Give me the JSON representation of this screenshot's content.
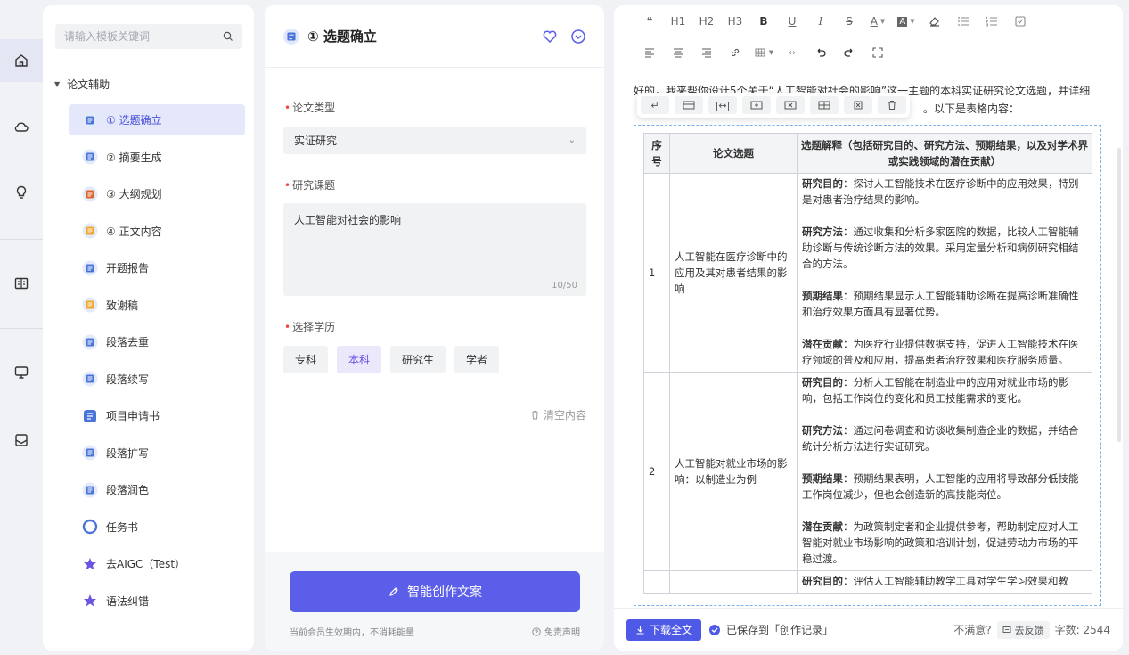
{
  "rail": {
    "icons": [
      "home-icon",
      "cloud-icon",
      "lightbulb-icon",
      "book-icon",
      "monitor-icon",
      "mail-icon"
    ]
  },
  "sidebar": {
    "search_placeholder": "请输入模板关键词",
    "group_label": "论文辅助",
    "items": [
      {
        "label": "① 选题确立",
        "icon": "topic-icon"
      },
      {
        "label": "② 摘要生成",
        "icon": "abstract-icon"
      },
      {
        "label": "③ 大纲规划",
        "icon": "outline-icon"
      },
      {
        "label": "④ 正文内容",
        "icon": "body-icon"
      },
      {
        "label": "开题报告",
        "icon": "report-icon"
      },
      {
        "label": "致谢稿",
        "icon": "thanks-icon"
      },
      {
        "label": "段落去重",
        "icon": "dedupe-icon"
      },
      {
        "label": "段落续写",
        "icon": "continue-icon"
      },
      {
        "label": "项目申请书",
        "icon": "proposal-icon"
      },
      {
        "label": "段落扩写",
        "icon": "expand-icon"
      },
      {
        "label": "段落润色",
        "icon": "polish-icon"
      },
      {
        "label": "任务书",
        "icon": "task-icon"
      },
      {
        "label": "去AIGC（Test）",
        "icon": "star-icon"
      },
      {
        "label": "语法纠错",
        "icon": "star-icon"
      }
    ]
  },
  "form": {
    "title": "① 选题确立",
    "type_label": "论文类型",
    "type_value": "实证研究",
    "topic_label": "研究课题",
    "topic_value": "人工智能对社会的影响",
    "topic_count": "10/50",
    "degree_label": "选择学历",
    "degree_options": [
      "专科",
      "本科",
      "研究生",
      "学者"
    ],
    "clear_label": "清空内容",
    "generate_label": "智能创作文案",
    "member_note": "当前会员生效期内，不消耗能量",
    "disclaimer": "免责声明"
  },
  "editor": {
    "toolbar_row1": [
      "❝",
      "H1",
      "H2",
      "H3",
      "B",
      "U",
      "I",
      "S",
      "A",
      "A",
      "⌫",
      "☰",
      "☷",
      "☑"
    ],
    "intro_line1": "好的，我来帮你设计5个关于“人工智能对社会的影响”这一主题的本科实证研究论文选题，并详细",
    "intro_line2": "。以下是表格内容：",
    "table": {
      "headers": [
        "序号",
        "论文选题",
        "选题解释（包括研究目的、研究方法、预期结果，以及对学术界或实践领域的潜在贡献）"
      ],
      "rows": [
        {
          "no": "1",
          "title": "人工智能在医疗诊断中的应用及其对患者结果的影响",
          "purpose_k": "研究目的",
          "purpose": "：探讨人工智能技术在医疗诊断中的应用效果，特别是对患者治疗结果的影响。",
          "method_k": "研究方法",
          "method": "：通过收集和分析多家医院的数据，比较人工智能辅助诊断与传统诊断方法的效果。采用定量分析和病例研究相结合的方法。",
          "result_k": "预期结果",
          "result": "：预期结果显示人工智能辅助诊断在提高诊断准确性和治疗效果方面具有显著优势。",
          "contrib_k": "潜在贡献",
          "contrib": "：为医疗行业提供数据支持，促进人工智能技术在医疗领域的普及和应用，提高患者治疗效果和医疗服务质量。"
        },
        {
          "no": "2",
          "title": "人工智能对就业市场的影响：以制造业为例",
          "purpose_k": "研究目的",
          "purpose": "：分析人工智能在制造业中的应用对就业市场的影响，包括工作岗位的变化和员工技能需求的变化。",
          "method_k": "研究方法",
          "method": "：通过问卷调查和访谈收集制造企业的数据，并结合统计分析方法进行实证研究。",
          "result_k": "预期结果",
          "result": "：预期结果表明，人工智能的应用将导致部分低技能工作岗位减少，但也会创造新的高技能岗位。",
          "contrib_k": "潜在贡献",
          "contrib": "：为政策制定者和企业提供参考，帮助制定应对人工智能对就业市场影响的政策和培训计划，促进劳动力市场的平稳过渡。"
        },
        {
          "no": "",
          "title": "",
          "purpose_k": "研究目的",
          "purpose": "：评估人工智能辅助教学工具对学生学习效果和教",
          "method_k": "",
          "method": "",
          "result_k": "",
          "result": "",
          "contrib_k": "",
          "contrib": ""
        }
      ]
    },
    "download_label": "下载全文",
    "saved_label": "已保存到「创作记录」",
    "unsatisfied_label": "不满意?",
    "feedback_label": "去反馈",
    "wordcount_label": "字数: 2544"
  }
}
